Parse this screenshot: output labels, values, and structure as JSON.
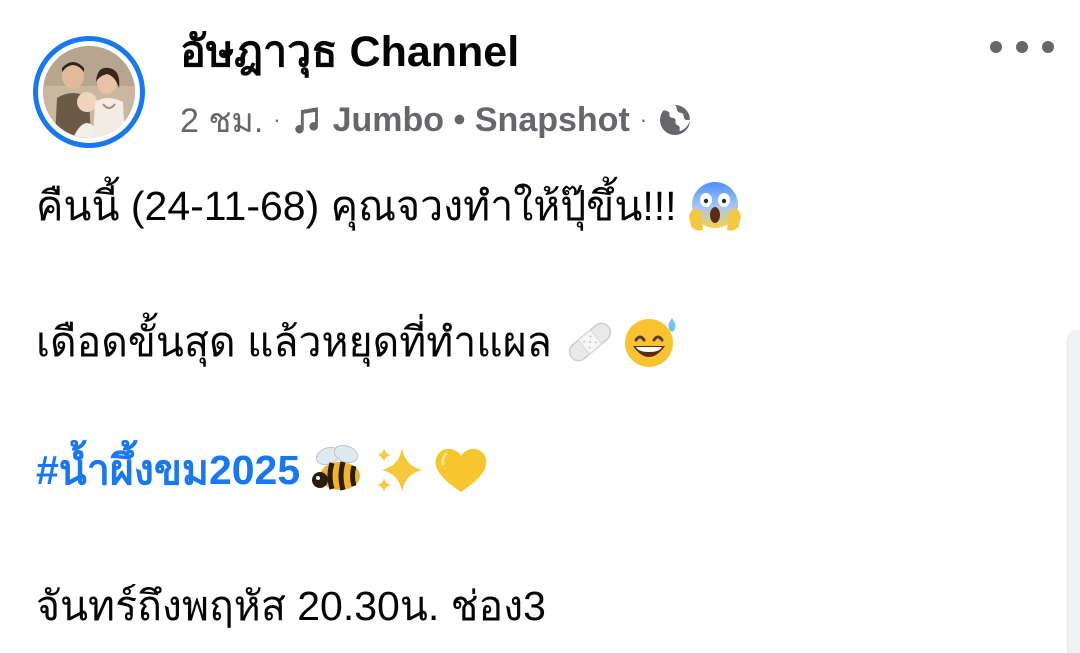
{
  "post": {
    "author": {
      "name": "อัษฎาวุธ Channel"
    },
    "meta": {
      "time": "2 ชม.",
      "separator": "·",
      "audio_label": "Jumbo • Snapshot",
      "audience_icon": "globe-icon",
      "music_icon": "music-note-icon"
    },
    "more_icon": "more-options-icon",
    "lines": {
      "line1": "คืนนี้ (24-11-68) คุณจวงทำให้ปุ๊ขึ้น!!!",
      "line1_emoji": "face-screaming-in-fear-emoji",
      "line2": "เดือดขั้นสุด แล้วหยุดที่ทำแผล",
      "line2_emojis": [
        "adhesive-bandage-emoji",
        "grinning-face-with-sweat-emoji"
      ],
      "hashtag": "#น้ำผึ้งขม2025",
      "hashtag_emojis": [
        "honeybee-emoji",
        "sparkles-emoji",
        "yellow-heart-emoji"
      ],
      "line4": "จันทร์ถึงพฤหัส 20.30น. ช่อง3"
    }
  },
  "colors": {
    "accent": "#1877f2",
    "text": "#050505",
    "secondary_text": "#65676b"
  }
}
